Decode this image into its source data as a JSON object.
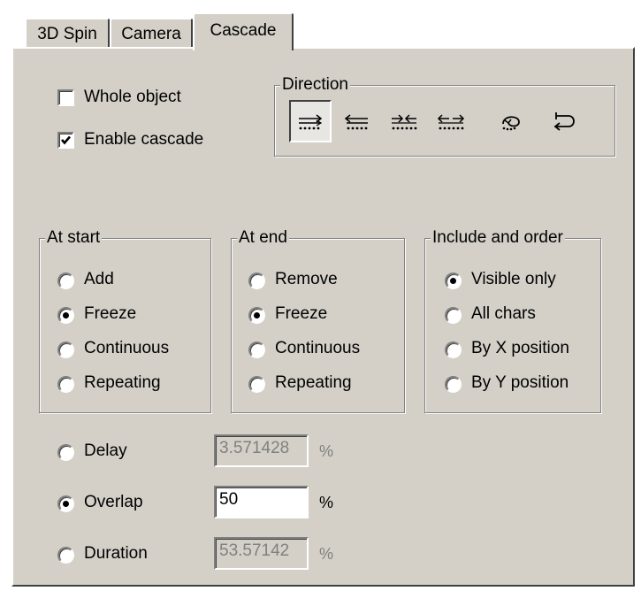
{
  "tabs": [
    {
      "label": "3D Spin"
    },
    {
      "label": "Camera"
    },
    {
      "label": "Cascade"
    }
  ],
  "checkboxes": {
    "whole_object": {
      "label": "Whole object",
      "checked": false
    },
    "enable_cascade": {
      "label": "Enable cascade",
      "checked": true
    }
  },
  "direction": {
    "legend": "Direction",
    "buttons": [
      {
        "icon": "cascade-left-to-right-icon",
        "pressed": true
      },
      {
        "icon": "cascade-right-to-left-icon",
        "pressed": false
      },
      {
        "icon": "cascade-inward-icon",
        "pressed": false
      },
      {
        "icon": "cascade-outward-icon",
        "pressed": false
      },
      {
        "icon": "cascade-spiral-icon",
        "pressed": false
      },
      {
        "icon": "cascade-loop-icon",
        "pressed": false
      }
    ]
  },
  "at_start": {
    "legend": "At start",
    "options": [
      "Add",
      "Freeze",
      "Continuous",
      "Repeating"
    ],
    "selected": "Freeze"
  },
  "at_end": {
    "legend": "At end",
    "options": [
      "Remove",
      "Freeze",
      "Continuous",
      "Repeating"
    ],
    "selected": "Freeze"
  },
  "include_order": {
    "legend": "Include and order",
    "options": [
      "Visible only",
      "All chars",
      "By X position",
      "By Y position"
    ],
    "selected": "Visible only"
  },
  "timing": {
    "delay": {
      "label": "Delay",
      "value": "3.571428",
      "unit": "%",
      "selected": false
    },
    "overlap": {
      "label": "Overlap",
      "value": "50",
      "unit": "%",
      "selected": true
    },
    "duration": {
      "label": "Duration",
      "value": "53.57142",
      "unit": "%",
      "selected": false
    }
  }
}
